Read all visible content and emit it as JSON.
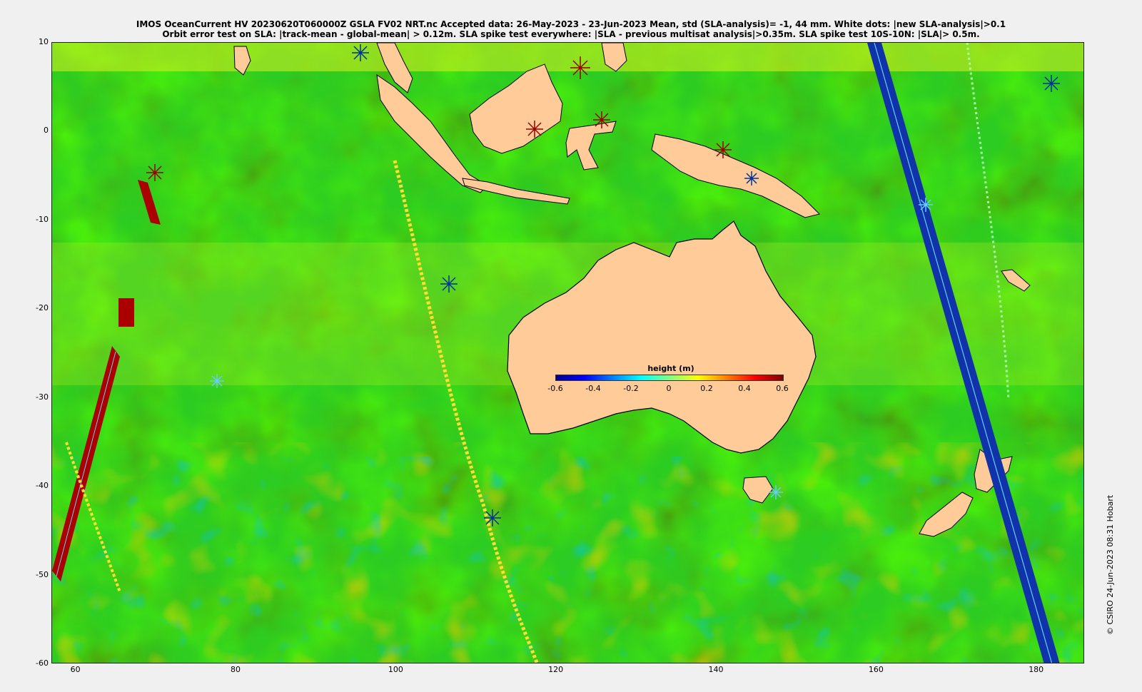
{
  "title_line1": "IMOS OceanCurrent HV 20230620T060000Z GSLA FV02 NRT.nc  Accepted data: 26-May-2023 - 23-Jun-2023 Mean, std (SLA-analysis)= -1, 44 mm. White dots: |new SLA-analysis|>0.1",
  "title_line2": "Orbit error test on SLA: |track-mean  - global-mean| > 0.12m.  SLA spike test everywhere: |SLA - previous multisat analysis|>0.35m. SLA spike test 10S-10N: |SLA|> 0.5m.",
  "map": {
    "lon_range": [
      57,
      186
    ],
    "lat_range": [
      -60,
      10
    ],
    "x_ticks": [
      "60",
      "80",
      "100",
      "120",
      "140",
      "160",
      "180"
    ],
    "y_ticks": [
      "10",
      "0",
      "-10",
      "-20",
      "-30",
      "-40",
      "-50",
      "-60"
    ],
    "x_tick_values": [
      60,
      80,
      100,
      120,
      140,
      160,
      180
    ],
    "y_tick_values": [
      10,
      0,
      -10,
      -20,
      -30,
      -40,
      -50,
      -60
    ],
    "ocean_color": "#33cc33",
    "land_color": "#ffcc99"
  },
  "colorbar": {
    "title": "height (m)",
    "ticks": [
      "-0.6",
      "-0.4",
      "-0.2",
      "0",
      "0.2",
      "0.4",
      "0.6"
    ],
    "tick_values": [
      -0.6,
      -0.4,
      -0.2,
      0,
      0.2,
      0.4,
      0.6
    ],
    "colors": [
      "#00008f",
      "#0000ff",
      "#0080ff",
      "#00ffff",
      "#80ff80",
      "#ffff00",
      "#ff8000",
      "#ff0000",
      "#800000"
    ]
  },
  "credit": "© CSIRO 24-Jun-2023 08:31 Hobart"
}
